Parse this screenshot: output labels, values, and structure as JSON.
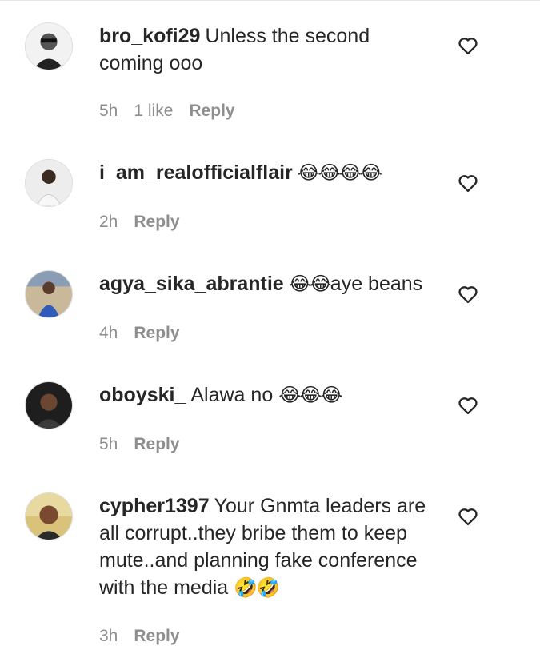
{
  "comments": [
    {
      "username": "bro_kofi29",
      "text": "Unless the second coming ooo",
      "emoji": "",
      "time": "5h",
      "likes": "1 like",
      "reply": "Reply"
    },
    {
      "username": "i_am_realofficialflair",
      "text": "",
      "emoji": "😂😂😂😂",
      "time": "2h",
      "likes": "",
      "reply": "Reply"
    },
    {
      "username": "agya_sika_abrantie",
      "text": "aye beans",
      "emoji": "😂😂",
      "time": "4h",
      "likes": "",
      "reply": "Reply"
    },
    {
      "username": "oboyski_",
      "text": "Alawa no",
      "emoji": "😂😂😂",
      "time": "5h",
      "likes": "",
      "reply": "Reply"
    },
    {
      "username": "cypher1397",
      "text": "Your Gnmta leaders are all corrupt..they bribe them to keep mute..and planning fake conference with the media",
      "emoji": "🤣🤣",
      "time": "3h",
      "likes": "",
      "reply": "Reply"
    }
  ]
}
